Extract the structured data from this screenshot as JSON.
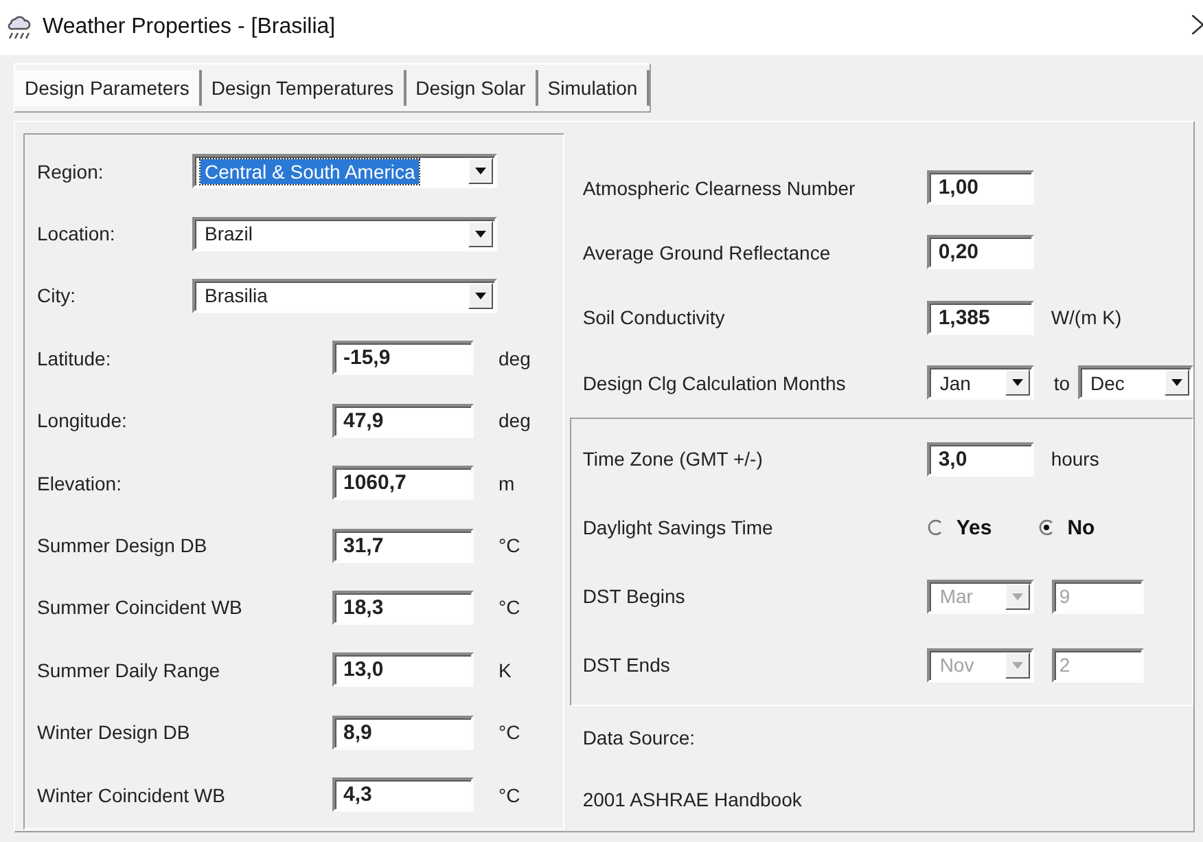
{
  "window": {
    "title": "Weather Properties - [Brasilia]"
  },
  "tabs": [
    {
      "label": "Design Parameters",
      "selected": true
    },
    {
      "label": "Design Temperatures",
      "selected": false
    },
    {
      "label": "Design Solar",
      "selected": false
    },
    {
      "label": "Simulation",
      "selected": false
    }
  ],
  "left_fields": [
    {
      "kind": "combo",
      "label": "Region:",
      "value": "Central & South America",
      "highlighted": true
    },
    {
      "kind": "combo",
      "label": "Location:",
      "value": "Brazil",
      "highlighted": false
    },
    {
      "kind": "combo",
      "label": "City:",
      "value": "Brasilia",
      "highlighted": false
    },
    {
      "kind": "number",
      "label": "Latitude:",
      "value": "-15,9",
      "unit": "deg"
    },
    {
      "kind": "number",
      "label": "Longitude:",
      "value": "47,9",
      "unit": "deg"
    },
    {
      "kind": "number",
      "label": "Elevation:",
      "value": "1060,7",
      "unit": "m"
    },
    {
      "kind": "number",
      "label": "Summer Design DB",
      "value": "31,7",
      "unit": "°C"
    },
    {
      "kind": "number",
      "label": "Summer Coincident WB",
      "value": "18,3",
      "unit": "°C"
    },
    {
      "kind": "number",
      "label": "Summer Daily Range",
      "value": "13,0",
      "unit": "K"
    },
    {
      "kind": "number",
      "label": "Winter Design DB",
      "value": "8,9",
      "unit": "°C"
    },
    {
      "kind": "number",
      "label": "Winter Coincident WB",
      "value": "4,3",
      "unit": "°C"
    }
  ],
  "right_fields": [
    {
      "kind": "number",
      "label": "Atmospheric Clearness Number",
      "value": "1,00"
    },
    {
      "kind": "number",
      "label": "Average Ground Reflectance",
      "value": "0,20"
    },
    {
      "kind": "number",
      "label": "Soil Conductivity",
      "value": "1,385",
      "unit": "W/(m K)"
    },
    {
      "kind": "month_range",
      "label": "Design Clg Calculation Months",
      "from": "Jan",
      "joiner": "to",
      "to": "Dec"
    }
  ],
  "time_group": [
    {
      "kind": "number",
      "label": "Time Zone (GMT +/-)",
      "value": "3,0",
      "unit": "hours"
    },
    {
      "kind": "radio",
      "label": "Daylight Savings Time",
      "options": [
        {
          "label": "Yes",
          "selected": false
        },
        {
          "label": "No",
          "selected": true
        }
      ]
    },
    {
      "kind": "month_day",
      "label": "DST Begins",
      "month": "Mar",
      "day": "9",
      "disabled": true
    },
    {
      "kind": "month_day",
      "label": "DST Ends",
      "month": "Nov",
      "day": "2",
      "disabled": true
    }
  ],
  "data_source": {
    "label": "Data Source:",
    "value": "2001 ASHRAE Handbook"
  }
}
